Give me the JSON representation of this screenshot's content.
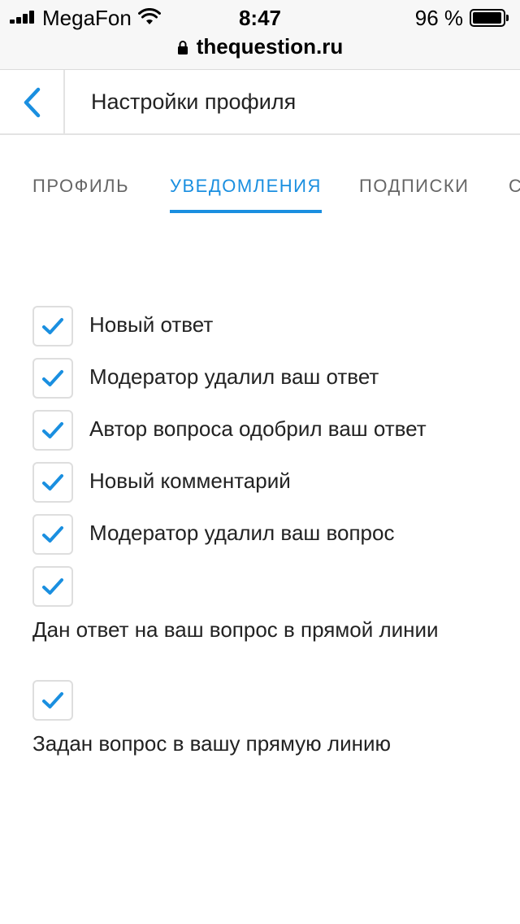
{
  "status_bar": {
    "carrier": "MegaFon",
    "time": "8:47",
    "battery_percent": "96 %",
    "battery_level": 0.96,
    "signal_bars": 4
  },
  "browser": {
    "url": "thequestion.ru"
  },
  "header": {
    "title": "Настройки профиля"
  },
  "tabs": [
    {
      "label": "ПРОФИЛЬ",
      "active": false
    },
    {
      "label": "УВЕДОМЛЕНИЯ",
      "active": true
    },
    {
      "label": "ПОДПИСКИ",
      "active": false
    },
    {
      "label": "С",
      "active": false
    }
  ],
  "notifications": [
    {
      "label": "Новый ответ",
      "checked": true
    },
    {
      "label": "Модератор удалил ваш ответ",
      "checked": true
    },
    {
      "label": "Автор вопроса одобрил ваш ответ",
      "checked": true
    },
    {
      "label": "Новый комментарий",
      "checked": true
    },
    {
      "label": "Модератор удалил ваш вопрос",
      "checked": true
    },
    {
      "label": "Дан ответ на ваш вопрос в прямой линии",
      "checked": true
    },
    {
      "label": "Задан вопрос в вашу прямую линию",
      "checked": true
    }
  ],
  "colors": {
    "accent": "#1a8fe0",
    "text": "#222222",
    "muted": "#666666"
  }
}
